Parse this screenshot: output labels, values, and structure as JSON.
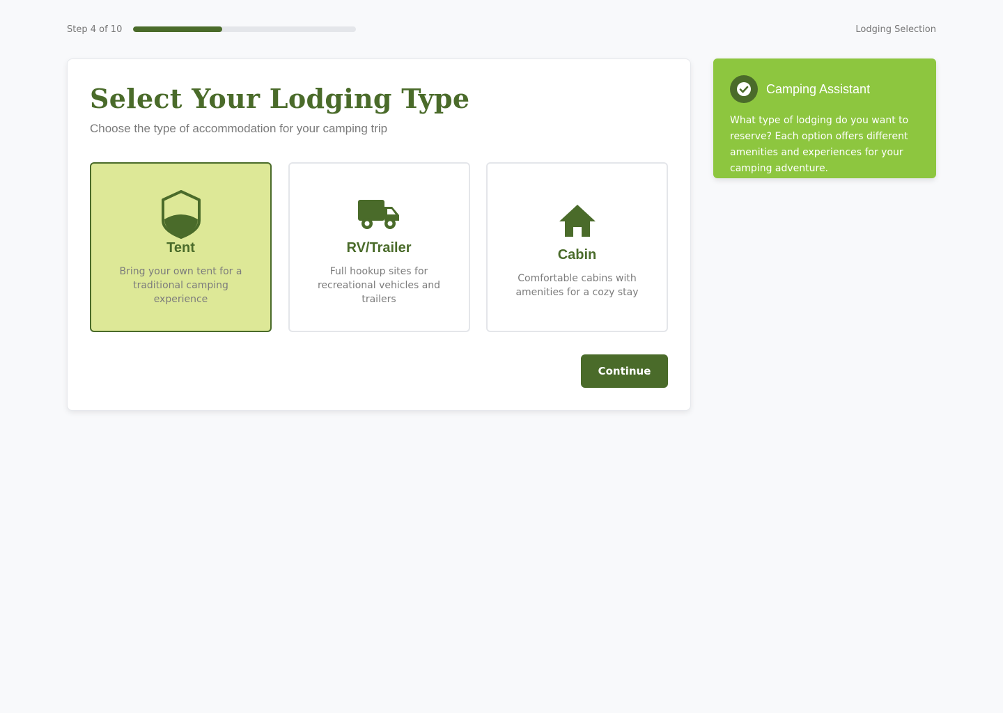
{
  "progress": {
    "step_label": "Step 4 of 10",
    "fraction": 0.4,
    "section_label": "Lodging Selection"
  },
  "main": {
    "title": "Select Your Lodging Type",
    "subtitle": "Choose the type of accommodation for your camping trip",
    "options": [
      {
        "title": "Tent",
        "description": "Bring your own tent for a traditional camping experience",
        "icon": "tent-icon",
        "selected": true
      },
      {
        "title": "RV/Trailer",
        "description": "Full hookup sites for recreational vehicles and trailers",
        "icon": "truck-icon",
        "selected": false
      },
      {
        "title": "Cabin",
        "description": "Comfortable cabins with amenities for a cozy stay",
        "icon": "house-icon",
        "selected": false
      }
    ],
    "continue_label": "Continue"
  },
  "assistant": {
    "title": "Camping Assistant",
    "icon": "check-circle-icon",
    "message": "What type of lodging do you want to reserve? Each option offers different amenities and experiences for your camping adventure."
  },
  "colors": {
    "primary": "#4a6b2a",
    "accent": "#8dc63f",
    "selected_bg": "#dde897",
    "page_bg": "#f8f9fb"
  }
}
